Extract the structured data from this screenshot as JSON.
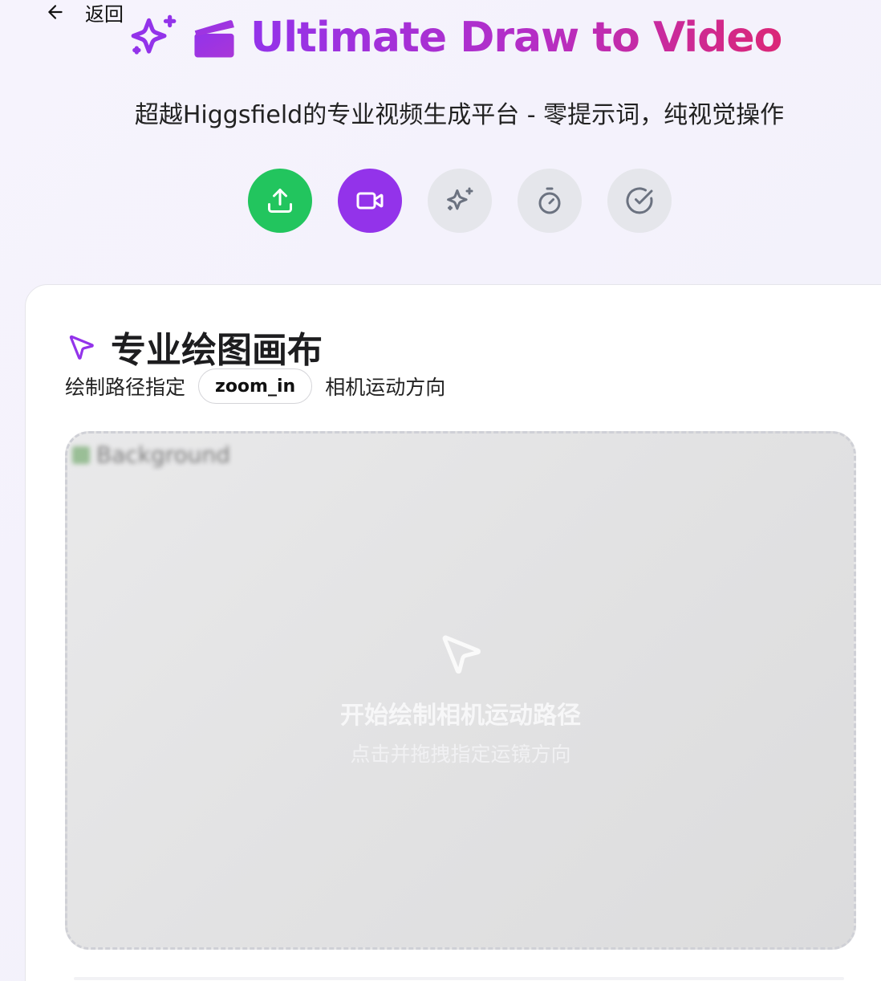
{
  "nav": {
    "back_label": "返回"
  },
  "header": {
    "title": "Ultimate Draw to Video",
    "subtitle": "超越Higgsfield的专业视频生成平台 - 零提示词，纯视觉操作",
    "accent_gradient": [
      "#9333ea",
      "#db2777"
    ]
  },
  "steps": [
    {
      "icon": "upload-icon",
      "state": "done",
      "color": "#22c55e"
    },
    {
      "icon": "video-icon",
      "state": "active",
      "color": "#9333ea"
    },
    {
      "icon": "sparkles-icon",
      "state": "pending",
      "color": "#e5e6eb"
    },
    {
      "icon": "timer-icon",
      "state": "pending",
      "color": "#e5e6eb"
    },
    {
      "icon": "check-circle-icon",
      "state": "pending",
      "color": "#e5e6eb"
    }
  ],
  "canvas_card": {
    "title": "专业绘图画布",
    "instruction_prefix": "绘制路径指定",
    "motion_tag": "zoom_in",
    "instruction_suffix": "相机运动方向",
    "background_alt": "Background",
    "empty_title": "开始绘制相机运动路径",
    "empty_hint": "点击并拖拽指定运镜方向"
  }
}
